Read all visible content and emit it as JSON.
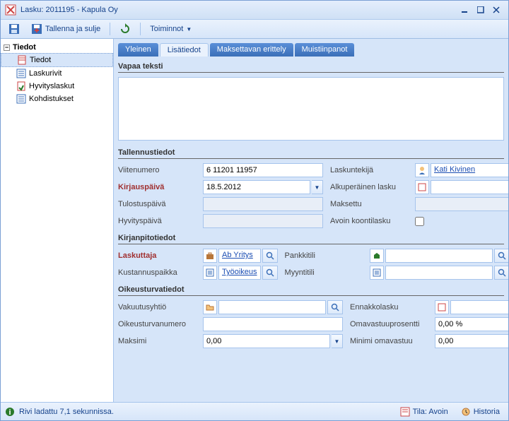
{
  "window": {
    "title": "Lasku: 2011195 - Kapula Oy"
  },
  "toolbar": {
    "save_close": "Tallenna ja sulje",
    "actions": "Toiminnot"
  },
  "sidebar": {
    "root": "Tiedot",
    "items": [
      {
        "label": "Tiedot"
      },
      {
        "label": "Laskurivit"
      },
      {
        "label": "Hyvityslaskut"
      },
      {
        "label": "Kohdistukset"
      }
    ]
  },
  "tabs": [
    {
      "label": "Yleinen"
    },
    {
      "label": "Lisätiedot"
    },
    {
      "label": "Maksettavan erittely"
    },
    {
      "label": "Muistiinpanot"
    }
  ],
  "sections": {
    "free_text": "Vapaa teksti",
    "save_info": "Tallennustiedot",
    "accounting": "Kirjanpitotiedot",
    "legal": "Oikeusturvatiedot"
  },
  "labels": {
    "viitenumero": "Viitenumero",
    "kirjauspaiva": "Kirjauspäivä",
    "tulostuspaiva": "Tulostuspäivä",
    "hyvityspaiva": "Hyvityspäivä",
    "laskuntekija": "Laskuntekijä",
    "alkup_lasku": "Alkuperäinen lasku",
    "maksettu": "Maksettu",
    "avoin_koonti": "Avoin koontilasku",
    "laskuttaja": "Laskuttaja",
    "kustannuspaikka": "Kustannuspaikka",
    "pankkitili": "Pankkitili",
    "myyntitili": "Myyntitili",
    "vakuutusyhtio": "Vakuutusyhtiö",
    "oikeusturvanumero": "Oikeusturvanumero",
    "maksimi": "Maksimi",
    "ennakkolasku": "Ennakkolasku",
    "omavastuupros": "Omavastuuprosentti",
    "minimi_omavastuu": "Minimi omavastuu"
  },
  "values": {
    "viitenumero": "6 11201 11957",
    "kirjauspaiva": "18.5.2012",
    "tulostuspaiva": "",
    "hyvityspaiva": "",
    "laskuntekija": "Kati Kivinen",
    "alkup_lasku": "",
    "maksettu": "",
    "laskuttaja": "Ab Yritys",
    "kustannuspaikka": "Työoikeus",
    "pankkitili": "",
    "myyntitili": "",
    "vakuutusyhtio": "",
    "oikeusturvanumero": "",
    "maksimi": "0,00",
    "ennakkolasku": "",
    "omavastuupros": "0,00 %",
    "minimi_omavastuu": "0,00",
    "free_text": ""
  },
  "status": {
    "message": "Rivi ladattu 7,1 sekunnissa.",
    "tila_label": "Tila: Avoin",
    "historia": "Historia"
  },
  "colors": {
    "accent": "#15428b",
    "required": "#a03030"
  }
}
